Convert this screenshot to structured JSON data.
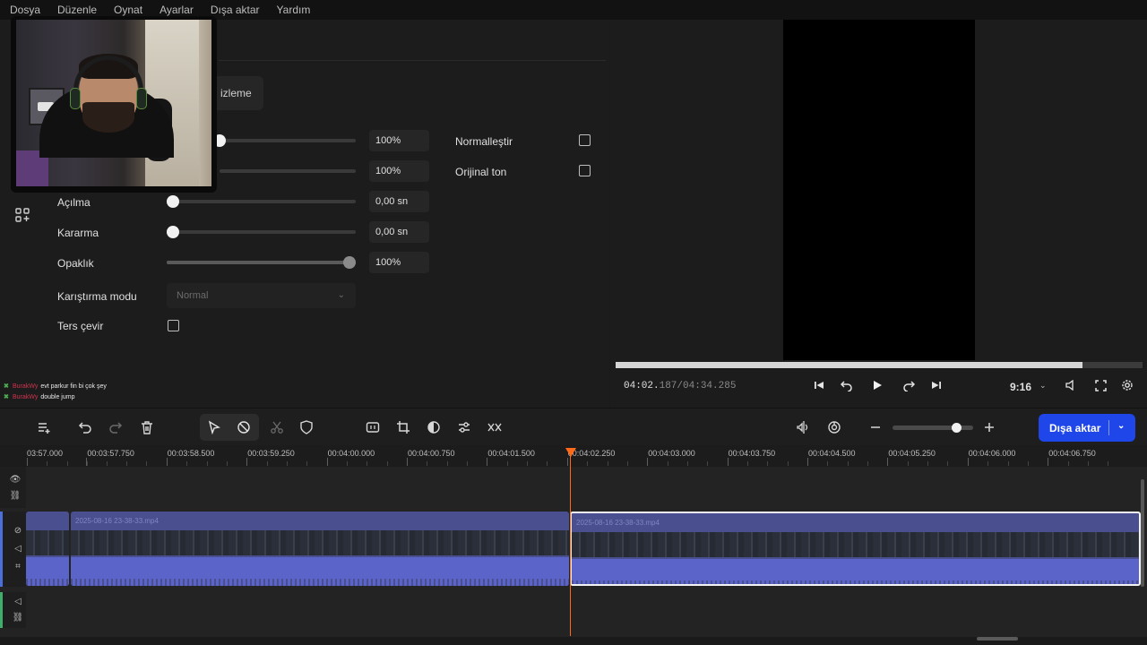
{
  "menu": [
    "Dosya",
    "Düzenle",
    "Oynat",
    "Ayarlar",
    "Dışa aktar",
    "Yardım"
  ],
  "left_panel": {
    "preview_button_label": "izleme",
    "properties": [
      {
        "label": "Açılma",
        "value": "0,00 sn",
        "level": 0.0
      },
      {
        "label": "Kararma",
        "value": "0,00 sn",
        "level": 0.0
      },
      {
        "label": "Opaklık",
        "value": "100%",
        "level": 1.0
      }
    ],
    "hidden_rows": [
      {
        "value": "100%"
      },
      {
        "value": "100%"
      }
    ],
    "blend_label": "Karıştırma modu",
    "blend_value": "Normal",
    "reverse_label": "Ters çevir",
    "checkboxes": [
      {
        "label": "Normalleştir",
        "checked": false
      },
      {
        "label": "Orijinal ton",
        "checked": false
      }
    ]
  },
  "preview": {
    "time_current_main": "04:02.",
    "time_current_ms": "187",
    "time_total": "/04:34.285",
    "progress": 0.886,
    "aspect_ratio": "9:16"
  },
  "chat": [
    {
      "user": "BurakWy",
      "message": "evt parkur fin bi çok şey"
    },
    {
      "user": "BurakWy",
      "message": "double jump"
    }
  ],
  "toolbar": {
    "export_label": "Dışa aktar",
    "zoom_level": 0.75
  },
  "ruler": {
    "labels": [
      "03:57.000",
      "00:03:57.750",
      "00:03:58.500",
      "00:03:59.250",
      "00:04:00.000",
      "00:04:00.750",
      "00:04:01.500",
      "00:04:02.250",
      "00:04:03.000",
      "00:04:03.750",
      "00:04:04.500",
      "00:04:05.250",
      "00:04:06.000",
      "00:04:06.750"
    ]
  },
  "clips": [
    {
      "title": "",
      "selected": false
    },
    {
      "title": "2025-08-16 23-38-33.mp4",
      "selected": false
    },
    {
      "title": "2025-08-16 23-38-33.mp4",
      "selected": true
    }
  ],
  "colors": {
    "accent": "#1f46e8",
    "playhead": "#ff6a1a",
    "clip": "#4a4f8f",
    "audio": "#5b64c9"
  }
}
